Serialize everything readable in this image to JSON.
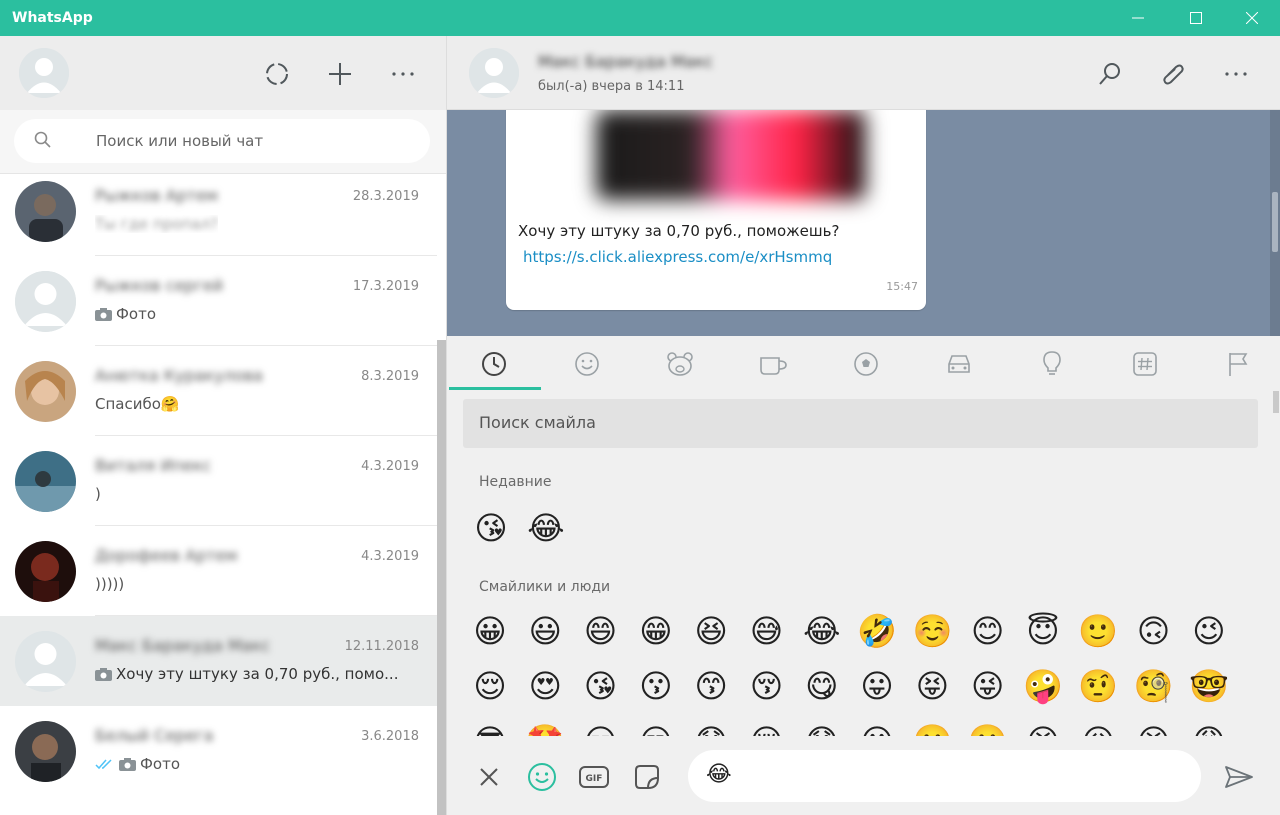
{
  "titlebar": {
    "title": "WhatsApp",
    "buttons": [
      "minimize-icon",
      "maximize-icon",
      "close-icon"
    ],
    "color": "#2bbf9f"
  },
  "left": {
    "header_icons": [
      "status-icon",
      "new-chat-icon",
      "menu-icon"
    ],
    "search": {
      "placeholder": "Поиск или новый чат",
      "icon": "search-icon"
    },
    "chats": [
      {
        "name": "Рыжков Артем",
        "date": "28.3.2019",
        "preview": "Ты где пропал?",
        "preview_blurred": true,
        "has_photo": false,
        "photo_label": "",
        "ticks": false,
        "avatar_color": "#4a5662",
        "avatar_type": "photo"
      },
      {
        "name": "Рыжков сергей",
        "date": "17.3.2019",
        "preview": "",
        "preview_blurred": false,
        "has_photo": true,
        "photo_label": "Фото",
        "ticks": false,
        "avatar_color": "#dfe5e7",
        "avatar_type": "default"
      },
      {
        "name": "Анютка Куракулова",
        "date": "8.3.2019",
        "preview": "Спасибо🤗",
        "preview_blurred": false,
        "has_photo": false,
        "photo_label": "",
        "ticks": false,
        "avatar_color": "#c9a57f",
        "avatar_type": "photo"
      },
      {
        "name": "Виталя Ипекс",
        "date": "4.3.2019",
        "preview": ")",
        "preview_blurred": false,
        "has_photo": false,
        "photo_label": "",
        "ticks": false,
        "avatar_color": "#3e6f86",
        "avatar_type": "photo"
      },
      {
        "name": "Дорофеев Артем",
        "date": "4.3.2019",
        "preview": ")))))",
        "preview_blurred": false,
        "has_photo": false,
        "photo_label": "",
        "ticks": false,
        "avatar_color": "#5a1e18",
        "avatar_type": "photo"
      },
      {
        "name": "Макс Баракуда Макс",
        "date": "12.11.2018",
        "preview": "Хочу эту штуку за 0,70 руб., помо...",
        "preview_blurred": false,
        "has_photo": true,
        "photo_label": "",
        "ticks": false,
        "avatar_color": "#dfe5e7",
        "avatar_type": "default",
        "active": true
      },
      {
        "name": "Белый Серега",
        "date": "3.6.2018",
        "preview": "",
        "preview_blurred": false,
        "has_photo": true,
        "photo_label": "Фото",
        "ticks": true,
        "avatar_color": "#3b3f44",
        "avatar_type": "photo"
      }
    ]
  },
  "right": {
    "contact": {
      "name": "Макс Баракуда Макс",
      "status": "был(-а) вчера в 14:11"
    },
    "header_icons": [
      "search-icon",
      "attach-icon",
      "menu-icon"
    ],
    "message": {
      "text": "Хочу эту штуку за 0,70 руб., поможешь?",
      "link": "https://s.click.aliexpress.com/e/xrHsmmq",
      "time": "15:47"
    },
    "chat_bg": "#7a8ca3",
    "emoji_panel": {
      "tabs": [
        "recent-icon",
        "smileys-icon",
        "animals-icon",
        "food-icon",
        "sports-icon",
        "travel-icon",
        "objects-icon",
        "symbols-icon",
        "flags-icon"
      ],
      "active_tab": 0,
      "search_placeholder": "Поиск смайла",
      "recent_label": "Недавние",
      "recent": [
        "😘",
        "😂"
      ],
      "smileys_label": "Смайлики и люди",
      "smileys_row1": [
        "😀",
        "😃",
        "😄",
        "😁",
        "😆",
        "😅",
        "😂",
        "🤣",
        "☺️",
        "😊",
        "😇",
        "🙂",
        "🙃",
        "😉"
      ],
      "smileys_row2": [
        "😌",
        "😍",
        "😘",
        "😗",
        "😙",
        "😚",
        "😋",
        "😛",
        "😝",
        "😜",
        "🤪",
        "🤨",
        "🧐",
        "🤓"
      ],
      "smileys_row3": [
        "😎",
        "🤩",
        "😏",
        "😒",
        "😞",
        "😔",
        "😟",
        "😕",
        "🙁",
        "☹️",
        "😣",
        "😖",
        "😫",
        "😩"
      ]
    },
    "footer": {
      "icons": [
        "close-icon",
        "emoji-icon",
        "gif-icon",
        "sticker-icon"
      ],
      "input_value": "😂",
      "send_icon": "send-icon"
    }
  }
}
